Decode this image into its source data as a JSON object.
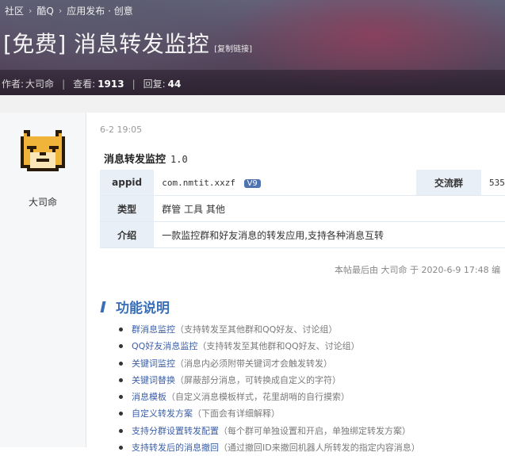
{
  "breadcrumb": [
    "社区",
    "酷Q",
    "应用发布 · 创意"
  ],
  "title": "[免费] 消息转发监控",
  "copy_link": "[复制链接]",
  "meta": {
    "author_label": "作者:",
    "author": "大司命",
    "views_label": "查看:",
    "views": "1913",
    "replies_label": "回复:",
    "replies": "44"
  },
  "post": {
    "author": "大司命",
    "date": "6-2 19:05",
    "plugin_name": "消息转发监控",
    "version": "1.0",
    "appid_label": "appid",
    "appid": "com.nmtit.xxzf",
    "appid_badge": "V9",
    "group_label": "交流群",
    "group_value": "535",
    "type_label": "类型",
    "type_value": "群管 工具 其他",
    "intro_label": "介绍",
    "intro_value": "一款监控群和好友消息的转发应用,支持各种消息互转",
    "edit_note": "本帖最后由 大司命 于 2020-6-9 17:48 编"
  },
  "features": {
    "title": "功能说明",
    "items": [
      {
        "name": "群消息监控",
        "desc": "（支持转发至其他群和QQ好友、讨论组）"
      },
      {
        "name": "QQ好友消息监控",
        "desc": "（支持转发至其他群和QQ好友、讨论组）"
      },
      {
        "name": "关键词监控",
        "desc": "（消息内必须附带关键词才会触发转发）"
      },
      {
        "name": "关键词替换",
        "desc": "（屏蔽部分消息，可转换成自定义的字符）"
      },
      {
        "name": "消息模板",
        "desc": "（自定义消息模板样式，花里胡哨的自行摸索）"
      },
      {
        "name": "自定义转发方案",
        "desc": "（下面会有详细解释）"
      },
      {
        "name": "支持分群设置转发配置",
        "desc": "（每个群可单独设置和开启，单独绑定转发方案）"
      },
      {
        "name": "支持转发后的消息撤回",
        "desc": "（通过撤回ID来撤回机器人所转发的指定内容消息）"
      }
    ]
  }
}
